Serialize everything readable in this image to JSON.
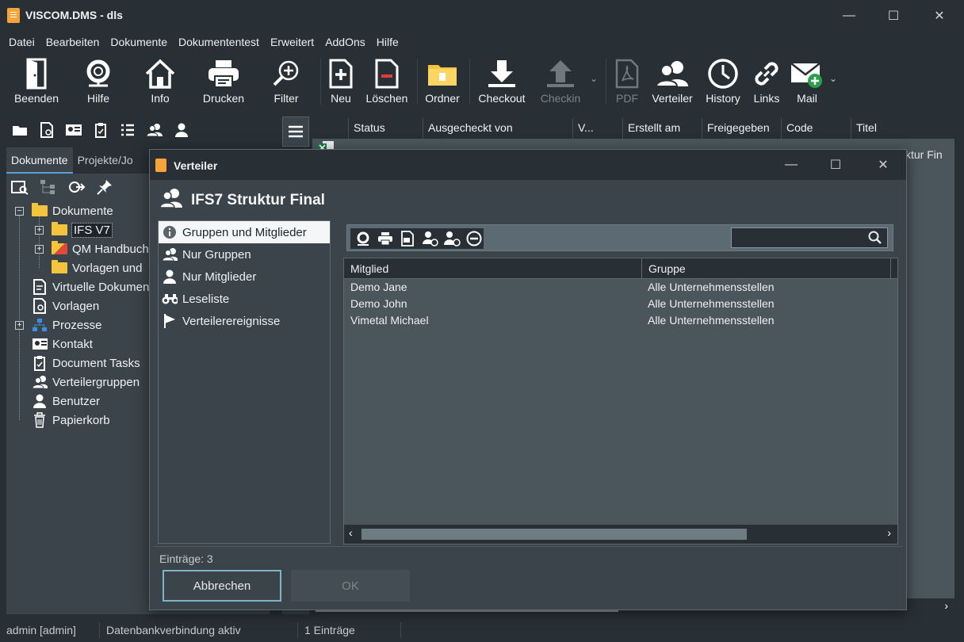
{
  "window": {
    "title": "VISCOM.DMS - dls"
  },
  "window_controls": {
    "minimize": "—",
    "maximize": "☐",
    "close": "✕"
  },
  "menu": [
    "Datei",
    "Bearbeiten",
    "Dokumente",
    "Dokumententest",
    "Erweitert",
    "AddOns",
    "Hilfe"
  ],
  "toolbar": {
    "beenden": "Beenden",
    "hilfe": "Hilfe",
    "info": "Info",
    "drucken": "Drucken",
    "filter": "Filter",
    "neu": "Neu",
    "loeschen": "Löschen",
    "ordner": "Ordner",
    "checkout": "Checkout",
    "checkin": "Checkin",
    "pdf": "PDF",
    "verteiler": "Verteiler",
    "history": "History",
    "links": "Links",
    "mail": "Mail"
  },
  "left_tabs": {
    "dokumente": "Dokumente",
    "projekte": "Projekte/Jo"
  },
  "tree": {
    "dokumente": "Dokumente",
    "ifs_v7": "IFS V7",
    "qm_handbuch": "QM Handbuch",
    "vorlagen_und": "Vorlagen und",
    "virtuelle": "Virtuelle Dokumen",
    "vorlagen": "Vorlagen",
    "prozesse": "Prozesse",
    "kontakt": "Kontakt",
    "document_tasks": "Document Tasks",
    "verteilergruppen": "Verteilergruppen",
    "benutzer": "Benutzer",
    "papierkorb": "Papierkorb"
  },
  "grid": {
    "columns": [
      "Status",
      "Ausgecheckt von",
      "V...",
      "Erstellt am",
      "Freigegeben",
      "Code",
      "Titel"
    ],
    "row_title_fragment": "ktur Fin"
  },
  "statusbar": {
    "user": "admin [admin]",
    "db": "Datenbankverbindung aktiv",
    "entries": "1 Einträge"
  },
  "dialog": {
    "caption": "Verteiler",
    "heading": "IFS7 Struktur Final",
    "nav": [
      "Gruppen und Mitglieder",
      "Nur Gruppen",
      "Nur Mitglieder",
      "Leseliste",
      "Verteilerereignisse"
    ],
    "search_value": "",
    "columns": {
      "member": "Mitglied",
      "group": "Gruppe"
    },
    "rows": [
      {
        "member": "Demo Jane",
        "group": "Alle Unternehmensstellen"
      },
      {
        "member": "Demo John",
        "group": "Alle Unternehmensstellen"
      },
      {
        "member": "Vimetal Michael",
        "group": "Alle Unternehmensstellen"
      }
    ],
    "entries": "Einträge: 3",
    "cancel": "Abbrechen",
    "ok": "OK"
  }
}
